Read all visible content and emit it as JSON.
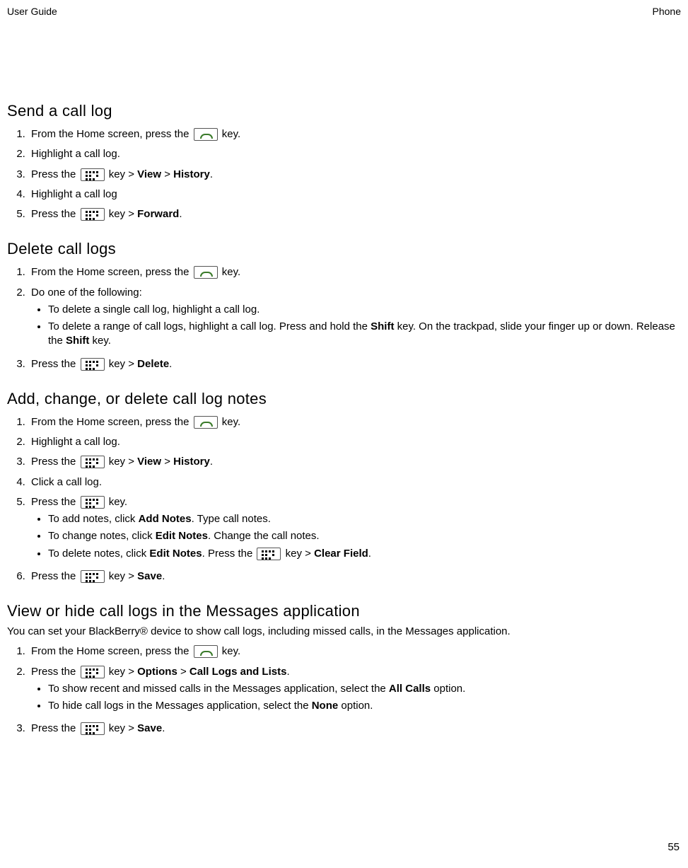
{
  "header": {
    "left": "User Guide",
    "right": "Phone"
  },
  "page_number": "55",
  "s1": {
    "heading": "Send a call log",
    "st1a": "From the Home screen, press the ",
    "st1b": " key.",
    "st2": "Highlight a call log.",
    "st3a": "Press the ",
    "st3b": " key > ",
    "st3_view": "View",
    "st3_hist": "History",
    "st3c": ".",
    "st4": "Highlight a call log",
    "st5a": "Press the ",
    "st5b": " key > ",
    "st5_fwd": "Forward",
    "st5c": "."
  },
  "s2": {
    "heading": "Delete call logs",
    "st1a": "From the Home screen, press the ",
    "st1b": " key.",
    "st2": "Do one of the following:",
    "b1": "To delete a single call log, highlight a call log.",
    "b2a": "To delete a range of call logs, highlight a call log. Press and hold the ",
    "b2_shift1": "Shift",
    "b2b": " key. On the trackpad, slide your finger up or down. Release the ",
    "b2_shift2": "Shift",
    "b2c": " key.",
    "st3a": "Press the ",
    "st3b": " key > ",
    "st3_del": "Delete",
    "st3c": "."
  },
  "s3": {
    "heading": "Add, change, or delete call log notes",
    "st1a": "From the Home screen, press the ",
    "st1b": " key.",
    "st2": "Highlight a call log.",
    "st3a": "Press the ",
    "st3b": " key > ",
    "st3_view": "View",
    "st3_hist": "History",
    "st3c": ".",
    "st4": "Click a call log.",
    "st5a": "Press the ",
    "st5b": " key.",
    "b1a": "To add notes, click ",
    "b1_add": "Add Notes",
    "b1b": ". Type call notes.",
    "b2a": "To change notes, click ",
    "b2_edit": "Edit Notes",
    "b2b": ". Change the call notes.",
    "b3a": "To delete notes, click ",
    "b3_edit": "Edit Notes",
    "b3b": ". Press the ",
    "b3c": " key > ",
    "b3_clear": "Clear Field",
    "b3d": ".",
    "st6a": "Press the ",
    "st6b": " key > ",
    "st6_save": "Save",
    "st6c": "."
  },
  "s4": {
    "heading": "View or hide call logs in the Messages application",
    "intro": "You can set your BlackBerry® device to show call logs, including missed calls, in the Messages application.",
    "st1a": "From the Home screen, press the ",
    "st1b": " key.",
    "st2a": "Press the ",
    "st2b": " key > ",
    "st2_opt": "Options",
    "st2_mid": " > ",
    "st2_cll": "Call Logs and Lists",
    "st2c": ".",
    "b1a": "To show recent and missed calls in the Messages application, select the ",
    "b1_all": "All Calls",
    "b1b": " option.",
    "b2a": "To hide call logs in the Messages application, select the ",
    "b2_none": "None",
    "b2b": " option.",
    "st3a": "Press the ",
    "st3b": " key > ",
    "st3_save": "Save",
    "st3c": "."
  }
}
